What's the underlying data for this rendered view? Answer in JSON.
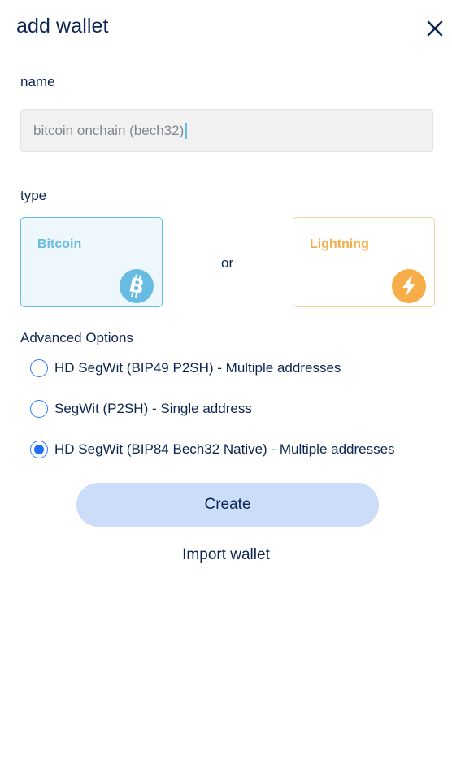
{
  "header": {
    "title": "add wallet",
    "close_icon": "close-icon"
  },
  "form": {
    "name_label": "name",
    "name_value": "bitcoin onchain (bech32)",
    "type_label": "type",
    "types": [
      {
        "label": "Bitcoin",
        "icon": "bitcoin-icon",
        "color": "#68bbe1",
        "selected": true
      },
      {
        "label": "Lightning",
        "icon": "lightning-icon",
        "color": "#f7ae48",
        "selected": false
      }
    ],
    "or_text": "or",
    "advanced_label": "Advanced Options",
    "options": [
      {
        "label": "HD SegWit (BIP49 P2SH) - Multiple addresses",
        "selected": false
      },
      {
        "label": "SegWit (P2SH) - Single address",
        "selected": false
      },
      {
        "label": "HD SegWit (BIP84 Bech32 Native) - Multiple addresses",
        "selected": true
      }
    ]
  },
  "actions": {
    "create_label": "Create",
    "import_label": "Import wallet"
  },
  "colors": {
    "text": "#0c2550",
    "accent": "#1f6ff6",
    "create_bg": "#ccddf9"
  }
}
